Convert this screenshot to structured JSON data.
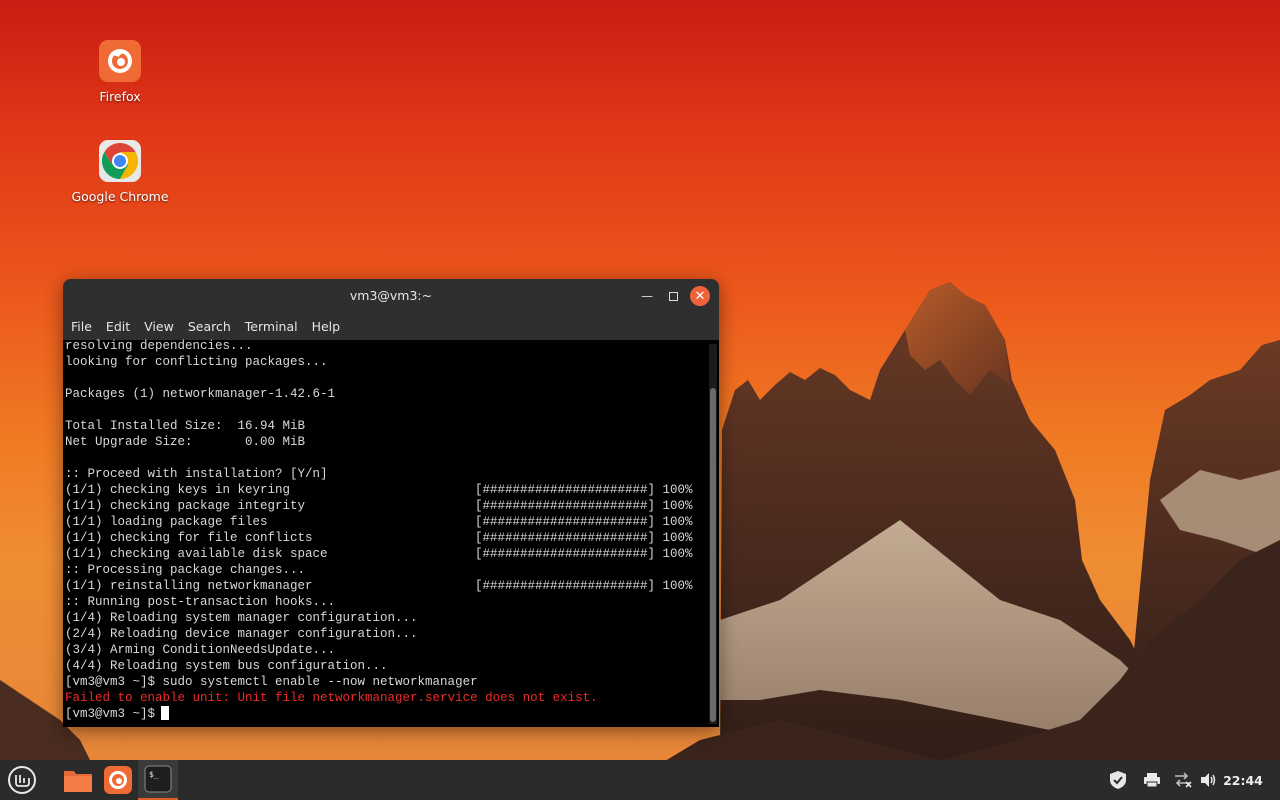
{
  "desktop": {
    "icons": [
      {
        "label": "Firefox",
        "icon": "firefox-icon"
      },
      {
        "label": "Google Chrome",
        "icon": "chrome-icon"
      }
    ]
  },
  "terminal": {
    "title": "vm3@vm3:~",
    "menu": [
      "File",
      "Edit",
      "View",
      "Search",
      "Terminal",
      "Help"
    ],
    "lines": [
      {
        "text": "resolving dependencies...",
        "progress": ""
      },
      {
        "text": "looking for conflicting packages...",
        "progress": ""
      },
      {
        "text": "",
        "progress": ""
      },
      {
        "text": "Packages (1) networkmanager-1.42.6-1",
        "progress": ""
      },
      {
        "text": "",
        "progress": ""
      },
      {
        "text": "Total Installed Size:  16.94 MiB",
        "progress": ""
      },
      {
        "text": "Net Upgrade Size:       0.00 MiB",
        "progress": ""
      },
      {
        "text": "",
        "progress": ""
      },
      {
        "text": ":: Proceed with installation? [Y/n]",
        "progress": ""
      },
      {
        "text": "(1/1) checking keys in keyring",
        "progress": "[######################] 100%"
      },
      {
        "text": "(1/1) checking package integrity",
        "progress": "[######################] 100%"
      },
      {
        "text": "(1/1) loading package files",
        "progress": "[######################] 100%"
      },
      {
        "text": "(1/1) checking for file conflicts",
        "progress": "[######################] 100%"
      },
      {
        "text": "(1/1) checking available disk space",
        "progress": "[######################] 100%"
      },
      {
        "text": ":: Processing package changes...",
        "progress": ""
      },
      {
        "text": "(1/1) reinstalling networkmanager",
        "progress": "[######################] 100%"
      },
      {
        "text": ":: Running post-transaction hooks...",
        "progress": ""
      },
      {
        "text": "(1/4) Reloading system manager configuration...",
        "progress": ""
      },
      {
        "text": "(2/4) Reloading device manager configuration...",
        "progress": ""
      },
      {
        "text": "(3/4) Arming ConditionNeedsUpdate...",
        "progress": ""
      },
      {
        "text": "(4/4) Reloading system bus configuration...",
        "progress": ""
      },
      {
        "text": "[vm3@vm3 ~]$ sudo systemctl enable --now networkmanager",
        "progress": ""
      }
    ],
    "error_line": "Failed to enable unit: Unit file networkmanager.service does not exist.",
    "prompt": "[vm3@vm3 ~]$",
    "colors": {
      "error": "#ef2929",
      "close_button": "#f0623a",
      "text": "#d8d8d8"
    }
  },
  "taskbar": {
    "launchers": [
      "mint-menu-icon",
      "folder-icon",
      "firefox-icon",
      "terminal-icon"
    ],
    "tray_icons": [
      "shield-icon",
      "printer-icon",
      "network-icon",
      "volume-icon"
    ],
    "clock": "22:44"
  }
}
